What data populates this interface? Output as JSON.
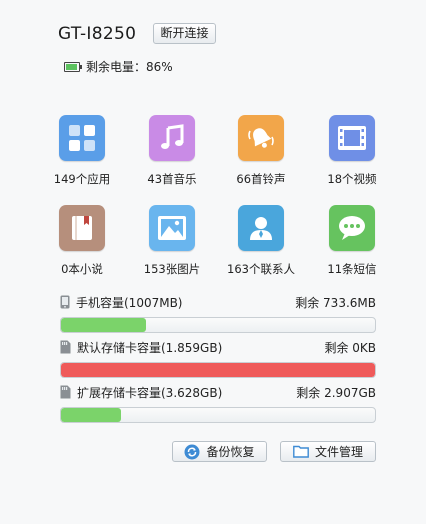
{
  "header": {
    "device_name": "GT-I8250",
    "disconnect_label": "断开连接",
    "battery_label": "剩余电量：86%",
    "battery_level": 0.86
  },
  "apps": [
    {
      "name": "apps",
      "label": "149个应用",
      "color": "#5a9ee8",
      "icon": "grid-icon"
    },
    {
      "name": "music",
      "label": "43首音乐",
      "color": "#c98be6",
      "icon": "music-note-icon"
    },
    {
      "name": "ringtones",
      "label": "66首铃声",
      "color": "#f2a64a",
      "icon": "bell-icon"
    },
    {
      "name": "videos",
      "label": "18个视频",
      "color": "#6f8fe6",
      "icon": "film-icon"
    },
    {
      "name": "novels",
      "label": "0本小说",
      "color": "#b68f7c",
      "icon": "book-icon"
    },
    {
      "name": "pictures",
      "label": "153张图片",
      "color": "#69b5ee",
      "icon": "picture-icon"
    },
    {
      "name": "contacts",
      "label": "163个联系人",
      "color": "#4aa6dc",
      "icon": "contact-icon"
    },
    {
      "name": "sms",
      "label": "11条短信",
      "color": "#66c35f",
      "icon": "chat-bubble-icon"
    }
  ],
  "storage": [
    {
      "label": "手机容量(1007MB)",
      "remaining": "剩余 733.6MB",
      "used_fraction": 0.27,
      "color": "#7bd36a",
      "icon": "phone-icon"
    },
    {
      "label": "默认存储卡容量(1.859GB)",
      "remaining": "剩余 0KB",
      "used_fraction": 1.0,
      "color": "#ef5a5a",
      "icon": "sdcard-icon"
    },
    {
      "label": "扩展存储卡容量(3.628GB)",
      "remaining": "剩余 2.907GB",
      "used_fraction": 0.19,
      "color": "#7bd36a",
      "icon": "sdcard-icon"
    }
  ],
  "actions": {
    "backup_label": "备份恢复",
    "files_label": "文件管理"
  }
}
